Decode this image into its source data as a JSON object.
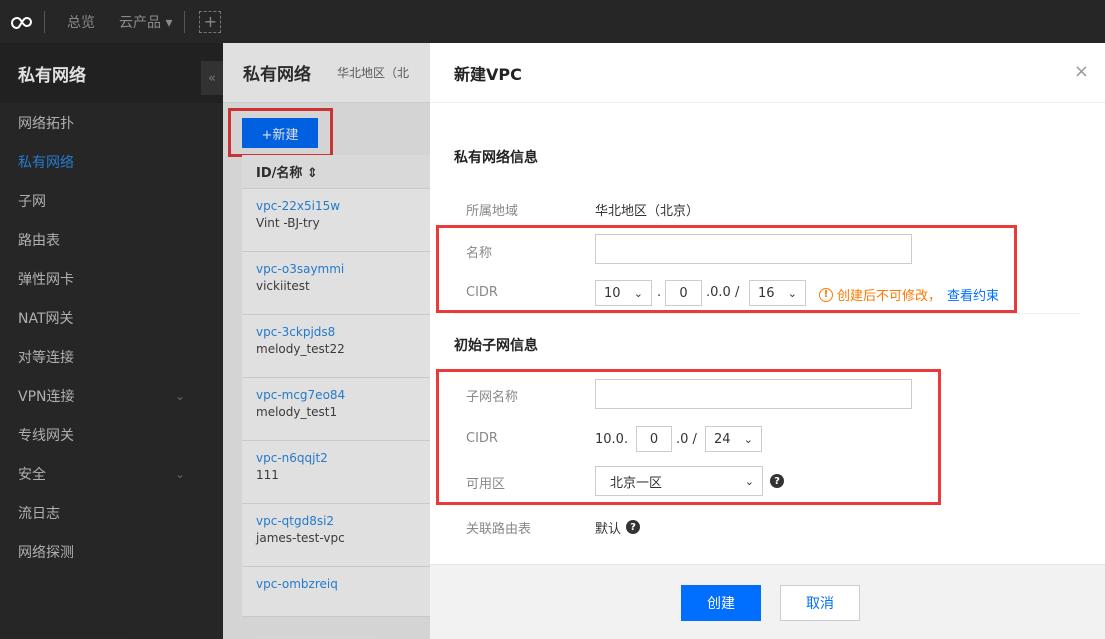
{
  "topbar": {
    "nav_overview": "总览",
    "nav_products": "云产品 ▾",
    "plus": "+"
  },
  "sidebar": {
    "title": "私有网络",
    "collapse_icon": "«",
    "items": [
      {
        "label": "网络拓扑"
      },
      {
        "label": "私有网络"
      },
      {
        "label": "子网"
      },
      {
        "label": "路由表"
      },
      {
        "label": "弹性网卡"
      },
      {
        "label": "NAT网关"
      },
      {
        "label": "对等连接"
      },
      {
        "label": "VPN连接"
      },
      {
        "label": "专线网关"
      },
      {
        "label": "安全"
      },
      {
        "label": "流日志"
      },
      {
        "label": "网络探测"
      }
    ]
  },
  "main": {
    "title": "私有网络",
    "region": "华北地区（北",
    "new_button": "+新建",
    "table_header": "ID/名称 ⇕",
    "rows": [
      {
        "id": "vpc-22x5i15w",
        "name": "Vint -BJ-try"
      },
      {
        "id": "vpc-o3saymmi",
        "name": "vickiitest"
      },
      {
        "id": "vpc-3ckpjds8",
        "name": "melody_test22"
      },
      {
        "id": "vpc-mcg7eo84",
        "name": "melody_test1"
      },
      {
        "id": "vpc-n6qqjt2",
        "name": "111"
      },
      {
        "id": "vpc-qtgd8si2",
        "name": "james-test-vpc"
      },
      {
        "id": "vpc-ombzreiq",
        "name": ""
      }
    ]
  },
  "dialog": {
    "title": "新建VPC",
    "close": "×",
    "vpc_section": "私有网络信息",
    "region_label": "所属地域",
    "region_value": "华北地区（北京）",
    "name_label": "名称",
    "name_value": "",
    "cidr_label": "CIDR",
    "cidr_first": "10",
    "cidr_dot": ".",
    "cidr_second": "0",
    "cidr_rest": ".0.0 /",
    "cidr_mask": "16",
    "warn_text": "创建后不可修改，",
    "warn_link": "查看约束",
    "subnet_section": "初始子网信息",
    "subnet_name_label": "子网名称",
    "subnet_name_value": "",
    "subnet_cidr_label": "CIDR",
    "subnet_cidr_prefix": "10.0.",
    "subnet_cidr_third": "0",
    "subnet_cidr_rest": ".0 /",
    "subnet_cidr_mask": "24",
    "zone_label": "可用区",
    "zone_value": "北京一区",
    "route_label": "关联路由表",
    "route_value": "默认",
    "create_button": "创建",
    "cancel_button": "取消"
  },
  "colors": {
    "accent": "#006eff",
    "highlight": "#e93a3a",
    "warning": "#ff7800"
  }
}
